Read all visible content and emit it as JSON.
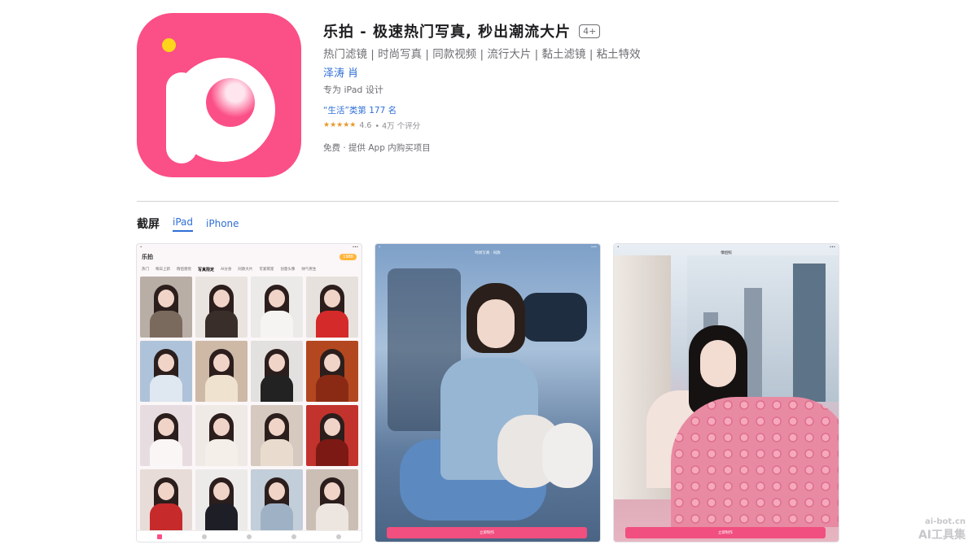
{
  "app": {
    "title": "乐拍 - 极速热门写真, 秒出潮流大片",
    "age_rating": "4+",
    "subtitle": "热门滤镜 | 时尚写真 | 同款视频 | 流行大片 | 黏土滤镜 | 粘土特效",
    "developer": "泽涛 肖",
    "device_note": "专为 iPad 设计",
    "rank": "“生活”类第 177 名",
    "stars": "★★★★★",
    "rating": "4.6",
    "rating_count": "• 4万 个评分",
    "price": "免费 · 提供 App 内购买项目",
    "brand_colors": {
      "primary": "#fb4f87",
      "dot": "#ffd51c",
      "link": "#2f6fd6"
    }
  },
  "screenshots": {
    "title": "截屏",
    "tabs": [
      {
        "label": "iPad",
        "active": true
      },
      {
        "label": "iPhone",
        "active": false
      }
    ],
    "shot1": {
      "logo": "乐拍",
      "coin": "1988",
      "categories": [
        "热门",
        "每日上新",
        "情侣感觉",
        "写真限定",
        "AI分身",
        "同款大片",
        "可爱萌宠",
        "创意头像",
        "帅气男生"
      ],
      "selected_category": "写真限定"
    },
    "shot2": {
      "title": "时尚写真 · 同款",
      "cta": "立即制作"
    },
    "shot3": {
      "title": "情侣照",
      "cta": "立即制作"
    }
  },
  "watermark": {
    "url": "ai-bot.cn",
    "name": "AI工具集"
  }
}
